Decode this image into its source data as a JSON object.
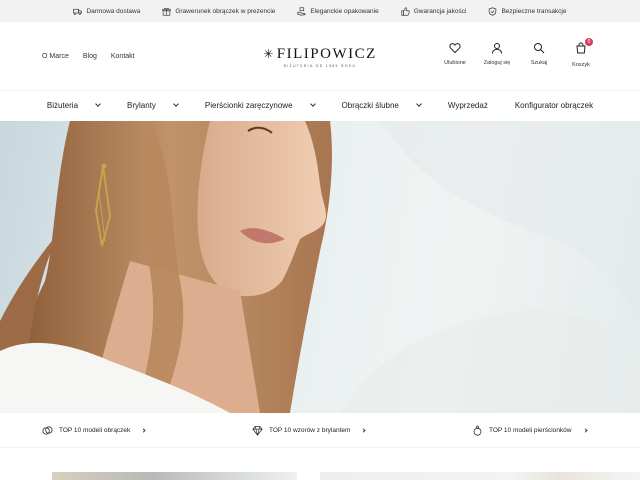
{
  "topbar": {
    "items": [
      {
        "label": "Darmowa dostawa",
        "icon": "truck-icon"
      },
      {
        "label": "Grawerunek obrączek w prezencie",
        "icon": "gift-icon"
      },
      {
        "label": "Eleganckie opakowanie",
        "icon": "hand-box-icon"
      },
      {
        "label": "Gwarancja jakości",
        "icon": "thumbs-up-icon"
      },
      {
        "label": "Bezpieczne transakcje",
        "icon": "shield-check-icon"
      }
    ]
  },
  "header": {
    "left_links": [
      "O Marce",
      "Blog",
      "Kontakt"
    ],
    "logo": {
      "name": "FILIPOWICZ",
      "tagline": "BIŻUTERIA OD 1985 ROKU"
    },
    "icons": [
      {
        "label": "Ulubione",
        "icon": "heart-icon"
      },
      {
        "label": "Zaloguj się",
        "icon": "user-icon"
      },
      {
        "label": "Szukaj",
        "icon": "search-icon"
      },
      {
        "label": "Koszyk",
        "icon": "cart-icon",
        "badge": "0"
      }
    ]
  },
  "mainnav": {
    "items": [
      {
        "label": "Biżuteria",
        "has_dropdown": true
      },
      {
        "label": "Brylanty",
        "has_dropdown": true
      },
      {
        "label": "Pierścionki zaręczynowe",
        "has_dropdown": true
      },
      {
        "label": "Obrączki ślubne",
        "has_dropdown": true
      },
      {
        "label": "Wyprzedaż",
        "has_dropdown": false
      },
      {
        "label": "Konfigurator obrączek",
        "has_dropdown": false
      }
    ]
  },
  "promo": {
    "items": [
      {
        "label": "TOP 10 modeli obrączek",
        "icon": "rings-icon"
      },
      {
        "label": "TOP 10 wzorów z brylantem",
        "icon": "diamond-icon"
      },
      {
        "label": "TOP 10 modeli pierścionków",
        "icon": "ring-icon"
      }
    ]
  },
  "colors": {
    "topbar_bg": "#f2f2f2",
    "badge": "#d63b5a",
    "hero_bg": "#dbe5e8"
  }
}
